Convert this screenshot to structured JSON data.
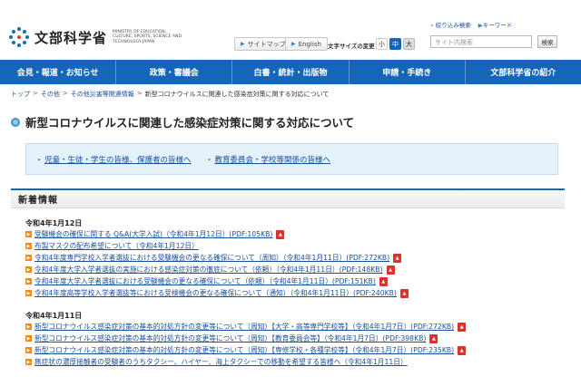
{
  "header": {
    "logo_title": "文部科学省",
    "logo_en": "MINISTRY OF EDUCATION, CULTURE, SPORTS, SCIENCE AND TECHNOLOGY-JAPAN",
    "sitemap_label": "サイトマップ",
    "english_label": "English",
    "font_size_label": "文字サイズの変更",
    "font_small": "小",
    "font_medium": "中",
    "font_large": "大",
    "search_refine_label": "絞り込み検索",
    "keyword_label": "キーワード",
    "search_placeholder": "サイト内検索",
    "search_button": "検索"
  },
  "gnav": [
    {
      "label": "会見・報道・お知らせ"
    },
    {
      "label": "政策・審議会"
    },
    {
      "label": "白書・統計・出版物"
    },
    {
      "label": "申請・手続き"
    },
    {
      "label": "文部科学省の紹介"
    }
  ],
  "breadcrumb": {
    "top": "トップ",
    "other": "その他",
    "disaster": "その他災害等関連情報",
    "current": "新型コロナウイルスに関連した感染症対策に関する対応について",
    "separator": ">"
  },
  "page_title": "新型コロナウイルスに関連した感染症対策に関する対応について",
  "linkbox": {
    "link1": "児童・生徒・学生の皆様、保護者の皆様へ",
    "link2": "教育委員会・学校等関係の皆様へ",
    "dot": "・"
  },
  "news": {
    "heading": "新着情報",
    "groups": [
      {
        "date": "令和4年1月12日",
        "items": [
          {
            "text": "受験機会の確保に関する Q&A(大学入試)（令和4年1月12日）(PDF:105KB)",
            "pdf": true
          },
          {
            "text": "布製マスクの配布希望について（令和4年1月12日）",
            "pdf": false
          },
          {
            "text": "令和4年度専門学校入学者選抜における受験機会の更なる確保について（周知）（令和4年1月11日）(PDF:272KB)",
            "pdf": true
          },
          {
            "text": "令和4年度大学入学者選抜の実施における感染症対策の徹底について（依頼）（令和4年1月11日）(PDF:148KB)",
            "pdf": true
          },
          {
            "text": "令和4年度大学入学者選抜における受験機会の更なる確保について（依頼）（令和4年1月11日）(PDF:151KB)",
            "pdf": true
          },
          {
            "text": "令和4年度高等学校入学者選抜等における受検機会の更なる確保について（通知）（令和4年1月11日）(PDF:240KB)",
            "pdf": true
          }
        ]
      },
      {
        "date": "令和4年1月11日",
        "items": [
          {
            "text": "新型コロナウイルス感染症対策の基本的対処方針の変更等について（周知）【大学・高等専門学校等】（令和4年1月7日）(PDF:272KB)",
            "pdf": true
          },
          {
            "text": "新型コロナウイルス感染症対策の基本的対処方針の変更等について（周知）【教育委員会等】（令和4年1月7日）(PDF:398KB)",
            "pdf": true
          },
          {
            "text": "新型コロナウイルス感染症対策の基本的対処方針の変更等について（周知）【専修学校・各種学校等】（令和4年1月7日）(PDF:235KB)",
            "pdf": true
          },
          {
            "text": "無症状の濃厚接触者の受験者のうちタクシー、ハイヤー、海上タクシーでの移動を希望する皆様へ（令和4年1月11日）",
            "pdf": false
          }
        ]
      }
    ]
  },
  "colors": {
    "nav_blue": "#1565b8",
    "link_blue": "#1a4f9c",
    "bullet_orange": "#f08c1e",
    "pdf_red": "#d9342b",
    "linkbox_bg": "#e5f2fb"
  },
  "icons": {
    "bullet": "orange-arrow-bullet-icon",
    "pdf": "pdf-icon",
    "title": "title-circle-icon"
  }
}
